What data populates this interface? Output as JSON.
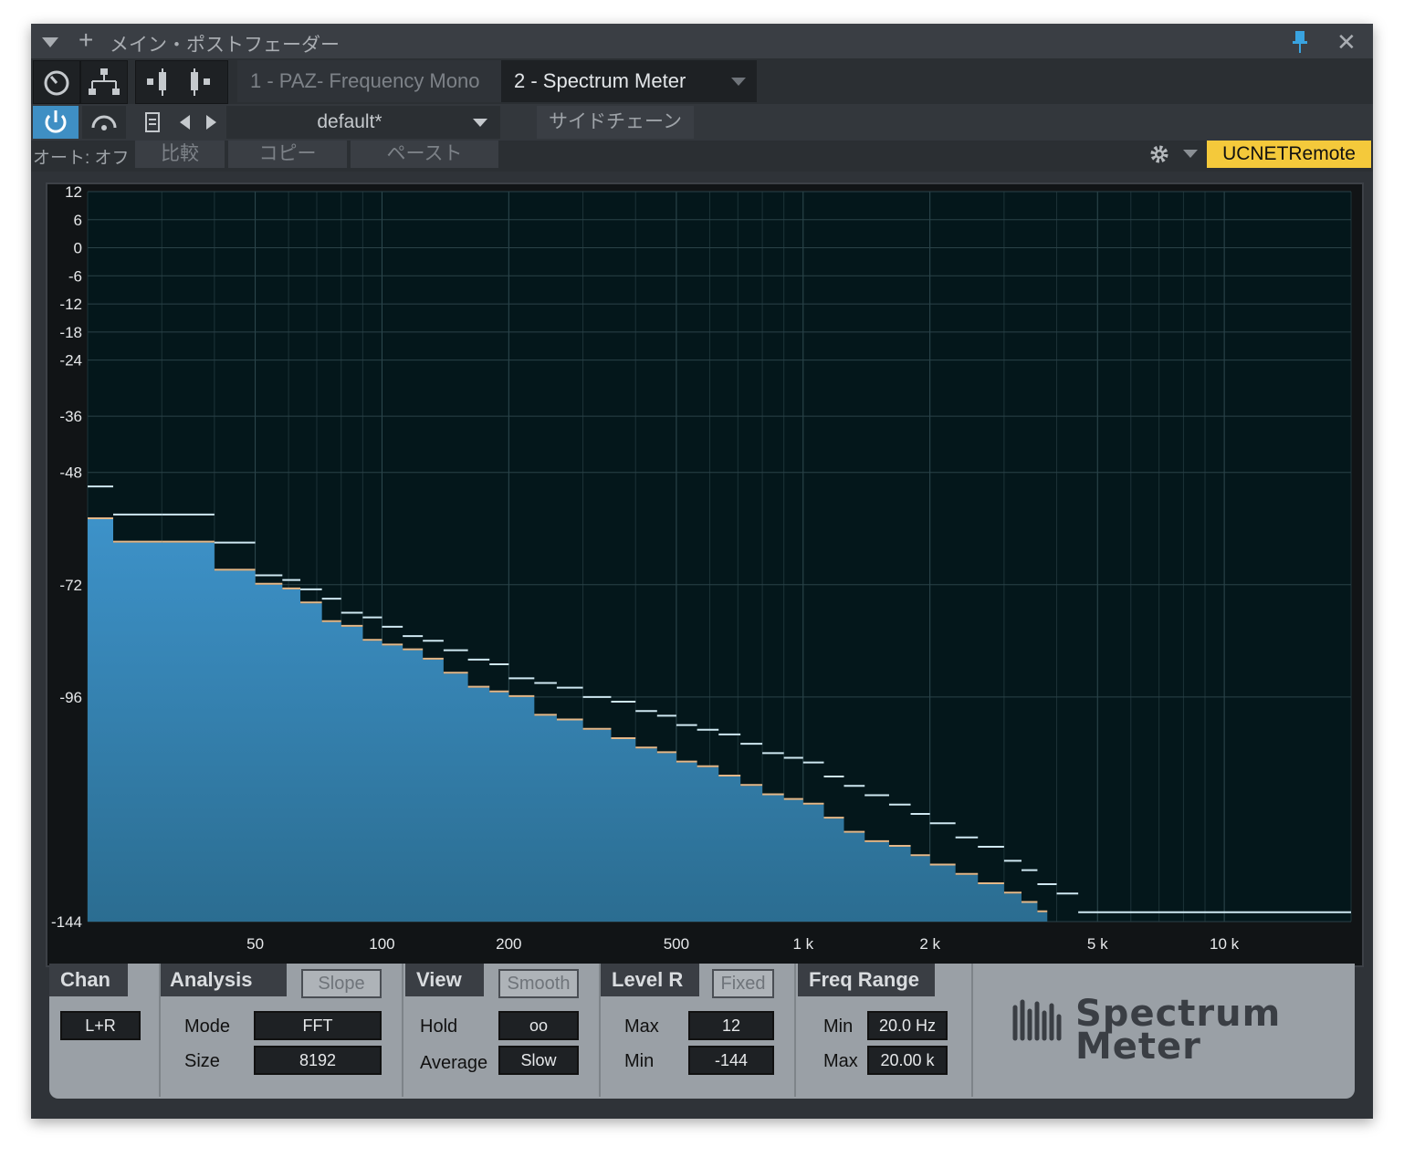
{
  "window": {
    "title": "メイン・ポストフェーダー",
    "tabs": [
      {
        "label": "1 - PAZ- Frequency Mono"
      },
      {
        "label": "2 - Spectrum Meter"
      }
    ],
    "preset": "default*",
    "sidechain": "サイドチェーン",
    "auto": "オート: オフ",
    "compare": "比較",
    "copy": "コピー",
    "paste": "ペースト",
    "remote": "UCNETRemote"
  },
  "colors": {
    "accent": "#3f8fc4",
    "remote_badge": "#f4c93b",
    "spectrum_fill": "#3b8cc0"
  },
  "chart_data": {
    "type": "area",
    "title": "",
    "x_scale": "log",
    "xlim": [
      20,
      20000
    ],
    "ylim": [
      -144,
      12
    ],
    "y_ticks": [
      12,
      6,
      0,
      -6,
      -12,
      -18,
      -24,
      -36,
      -48,
      -72,
      -96,
      -144
    ],
    "x_tick_labels": [
      {
        "value": 50,
        "label": "50"
      },
      {
        "value": 100,
        "label": "100"
      },
      {
        "value": 200,
        "label": "200"
      },
      {
        "value": 500,
        "label": "500"
      },
      {
        "value": 1000,
        "label": "1 k"
      },
      {
        "value": 2000,
        "label": "2 k"
      },
      {
        "value": 5000,
        "label": "5 k"
      },
      {
        "value": 10000,
        "label": "10 k"
      }
    ],
    "grid": true,
    "series": [
      {
        "x": [
          20,
          23,
          30,
          40,
          50,
          58,
          64,
          72,
          80,
          90,
          100,
          112,
          125,
          140,
          160,
          180,
          200,
          230,
          260,
          300,
          350,
          400,
          450,
          500,
          560,
          630,
          710,
          800,
          900,
          1000,
          1120,
          1250,
          1400,
          1600,
          1800,
          2000,
          2300,
          2600,
          3000,
          3300,
          3600,
          3800
        ],
        "values": [
          -58,
          -63,
          -63,
          -69,
          -72,
          -73,
          -76,
          -80,
          -81,
          -84,
          -85,
          -86,
          -88,
          -91,
          -94,
          -95,
          -96,
          -100,
          -101,
          -103,
          -105,
          -107,
          -108,
          -110,
          -111,
          -113,
          -115,
          -117,
          -118,
          -119,
          -122,
          -125,
          -127,
          -128,
          -130,
          -132,
          -134,
          -136,
          -138,
          -140,
          -142,
          -144
        ]
      },
      {
        "x": [
          20,
          23,
          30,
          40,
          50,
          58,
          64,
          72,
          80,
          90,
          100,
          112,
          125,
          140,
          160,
          180,
          200,
          230,
          260,
          300,
          350,
          400,
          450,
          500,
          560,
          630,
          710,
          800,
          900,
          1000,
          1120,
          1250,
          1400,
          1600,
          1800,
          2000,
          2300,
          2600,
          3000,
          3300,
          3600,
          4000,
          4500,
          20000
        ],
        "values": [
          -51,
          -57,
          -57,
          -63,
          -70,
          -71,
          -73,
          -75,
          -78,
          -79,
          -81,
          -83,
          -84,
          -86,
          -88,
          -89,
          -92,
          -93,
          -94,
          -96,
          -97,
          -99,
          -100,
          -102,
          -103,
          -104,
          -106,
          -108,
          -109,
          -110,
          -113,
          -115,
          -117,
          -119,
          -121,
          -123,
          -126,
          -128,
          -131,
          -133,
          -136,
          -138,
          -142,
          -142
        ]
      }
    ]
  },
  "controls": {
    "chan": {
      "title": "Chan",
      "value": "L+R"
    },
    "analysis": {
      "title": "Analysis",
      "slope": "Slope",
      "mode_label": "Mode",
      "mode": "FFT",
      "size_label": "Size",
      "size": "8192"
    },
    "view": {
      "title": "View",
      "smooth": "Smooth",
      "hold_label": "Hold",
      "hold": "oo",
      "average_label": "Average",
      "average": "Slow"
    },
    "level": {
      "title": "Level R",
      "fixed": "Fixed",
      "max_label": "Max",
      "max": "12",
      "min_label": "Min",
      "min": "-144"
    },
    "freq": {
      "title": "Freq Range",
      "min_label": "Min",
      "min": "20.0 Hz",
      "max_label": "Max",
      "max": "20.00 k"
    },
    "logo": {
      "line1": "Spectrum",
      "line2": "Meter"
    }
  }
}
